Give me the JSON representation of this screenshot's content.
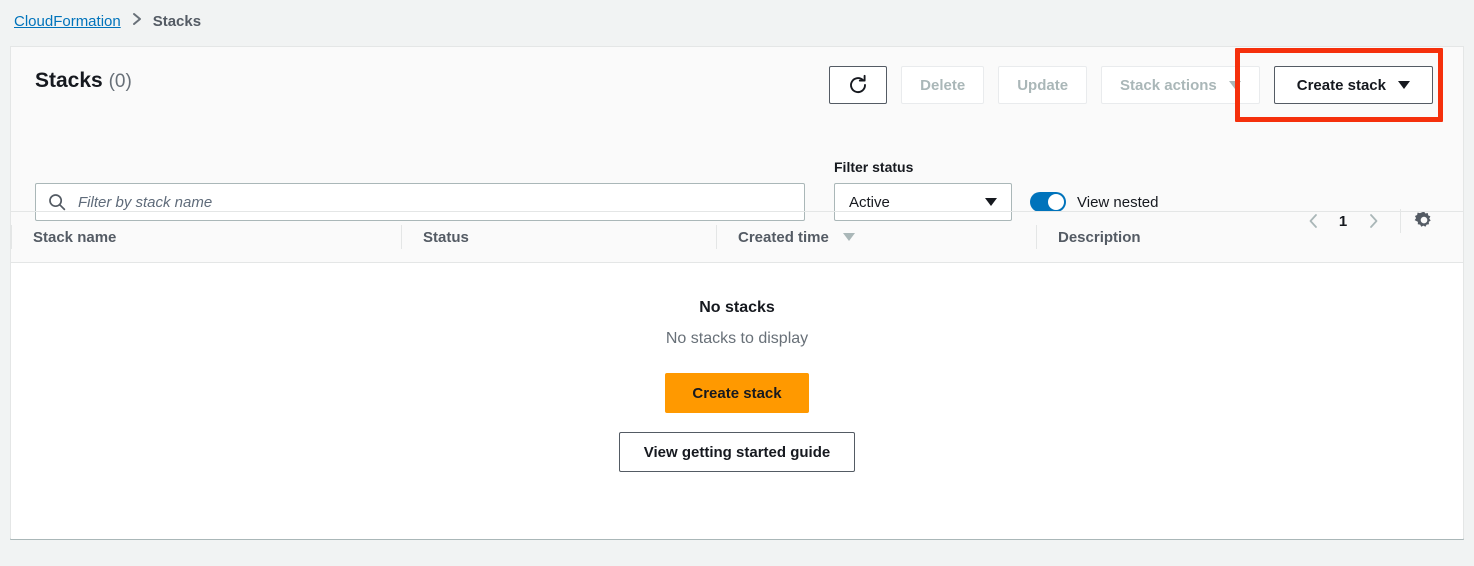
{
  "breadcrumb": {
    "root": "CloudFormation",
    "separator": "›",
    "current": "Stacks"
  },
  "card": {
    "title": "Stacks",
    "count": "(0)"
  },
  "toolbar": {
    "refresh_icon": "refresh-icon",
    "delete_label": "Delete",
    "update_label": "Update",
    "stack_actions_label": "Stack actions",
    "create_stack_label": "Create stack"
  },
  "filters": {
    "search_placeholder": "Filter by stack name",
    "search_value": "",
    "search_icon": "search-icon",
    "filter_status_label": "Filter status",
    "filter_status_value": "Active",
    "filter_status_options": [
      "Active"
    ],
    "view_nested_label": "View nested",
    "view_nested_on": true
  },
  "pagination": {
    "prev_icon": "chevron-left-icon",
    "page": "1",
    "next_icon": "chevron-right-icon",
    "settings_icon": "gear-icon"
  },
  "table": {
    "columns": [
      "Stack name",
      "Status",
      "Created time",
      "Description"
    ],
    "sorted_column": "Created time",
    "sort_direction": "descending",
    "rows": []
  },
  "empty_state": {
    "title": "No stacks",
    "subtitle": "No stacks to display",
    "primary_label": "Create stack",
    "secondary_label": "View getting started guide"
  },
  "colors": {
    "accent_orange": "#ff9900",
    "link_blue": "#0073bb",
    "toggle_blue": "#0073bb",
    "highlight_red": "#f5300c",
    "page_bg": "#f1f3f3",
    "card_bg": "#fafafa"
  }
}
